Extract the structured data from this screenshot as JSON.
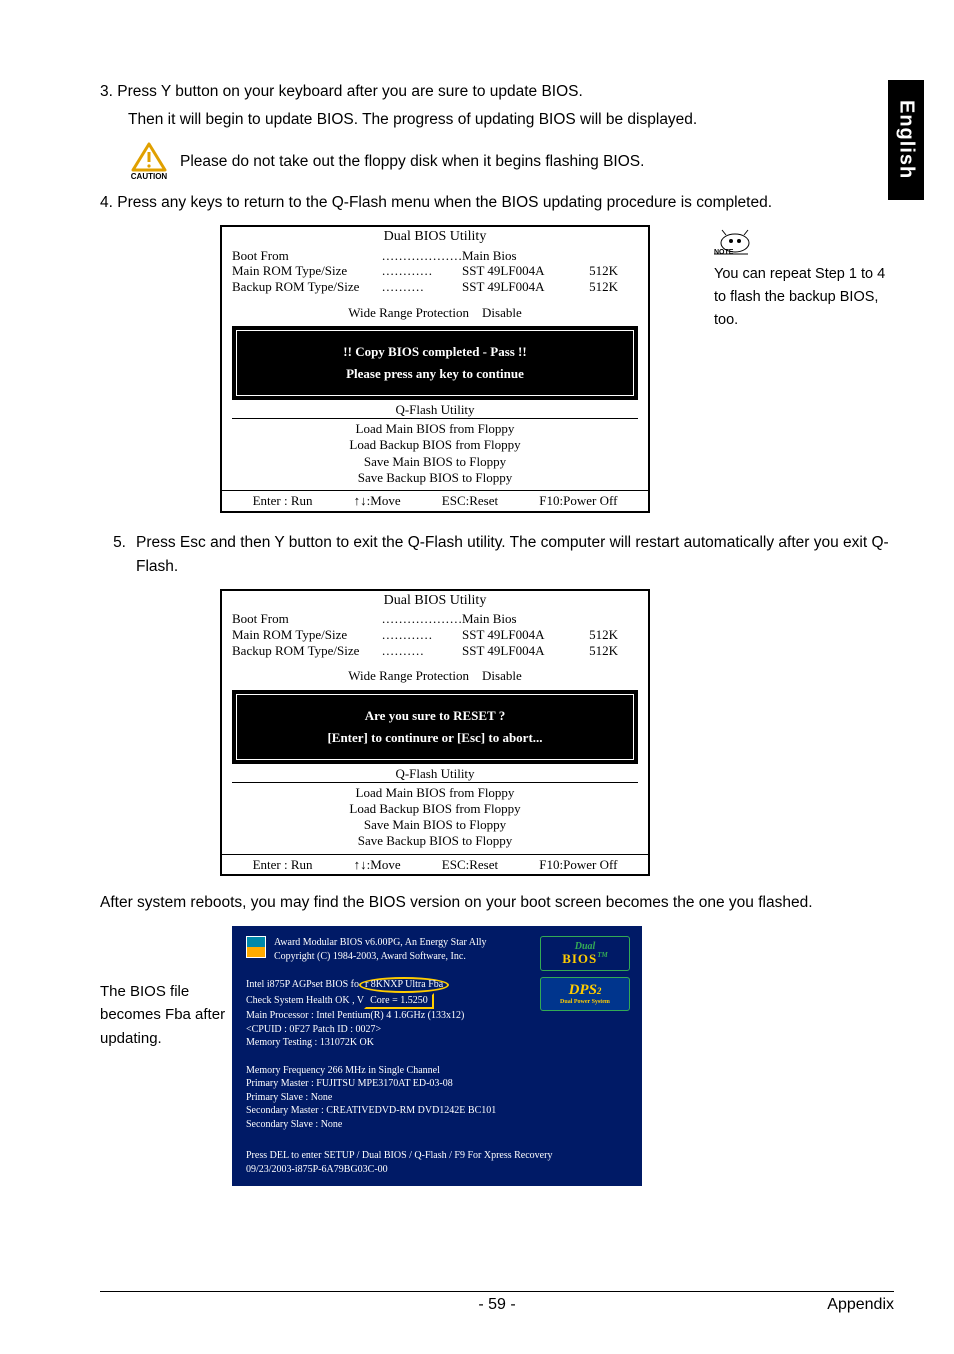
{
  "side_tab": "English",
  "step3_a": "3. Press Y button on your keyboard after you are sure to update BIOS.",
  "step3_b": "Then it will begin to update BIOS. The progress of updating BIOS will be displayed.",
  "caution_label": "CAUTION",
  "caution_text": "Please do not take out the floppy disk when it begins flashing BIOS.",
  "step4": "4. Press any keys to return to the Q-Flash menu when the BIOS updating procedure is completed.",
  "bios": {
    "title": "Dual BIOS Utility",
    "boot_from_label": "Boot From",
    "boot_from_val": "Main Bios",
    "main_rom_label": "Main ROM Type/Size",
    "main_rom_val": "SST 49LF004A",
    "main_rom_size": "512K",
    "backup_rom_label": "Backup ROM Type/Size",
    "backup_rom_val": "SST 49LF004A",
    "backup_rom_size": "512K",
    "wrp": "Wide Range Protection Disable",
    "box1_l1": "!! Copy BIOS completed - Pass !!",
    "box1_l2": "Please press any key to continue",
    "box2_l1": "Are you sure to RESET ?",
    "box2_l2": "[Enter] to continure or [Esc] to abort...",
    "qf_title": "Q-Flash Utility",
    "qf_menu": [
      "Load Main BIOS from Floppy",
      "Load Backup BIOS from Floppy",
      "Save Main BIOS to Floppy",
      "Save Backup BIOS to Floppy"
    ],
    "footer": {
      "enter": "Enter : Run",
      "move": "↑↓:Move",
      "esc": "ESC:Reset",
      "f10": "F10:Power Off"
    }
  },
  "note_label": "NOTE",
  "note_text": "You can repeat Step 1 to 4 to flash the backup BIOS, too.",
  "step5_num": "5.",
  "step5_txt": "Press Esc and then Y button to exit the Q-Flash utility. The computer will restart automatically after you exit Q-Flash.",
  "after_text": "After system reboots, you may find the BIOS version on your boot screen becomes the one you flashed.",
  "boot_note": "The BIOS file becomes Fba after updating.",
  "boot": {
    "award1": "Award Modular BIOS v6.00PG, An Energy Star Ally",
    "award2": "Copyright  (C)  1984-2003, Award Software,  Inc.",
    "l1a": "Intel i875P AGPset BIOS fo",
    "l1b": "r 8KNXP Ultra Fba",
    "l2a": "Check System Health OK ,  V",
    "l2b": "Core = 1.5250",
    "l3": "Main Processor : Intel Pentium(R) 4  1.6GHz (133x12)",
    "l4": "<CPUID : 0F27 Patch ID  : 0027>",
    "l5": "Memory Testing   : 131072K OK",
    "m1": "Memory Frequency 266 MHz in Single Channel",
    "m2": "Primary Master : FUJITSU MPE3170AT ED-03-08",
    "m3": "Primary Slave : None",
    "m4": "Secondary Master : CREATIVEDVD-RM DVD1242E BC101",
    "m5": "Secondary Slave : None",
    "b1": "Press DEL to enter SETUP / Dual BIOS / Q-Flash / F9 For Xpress Recovery",
    "b2": "09/23/2003-i875P-6A79BG03C-00",
    "logo_dual_top": "Dual",
    "logo_dual_bios": "BIOS",
    "logo_dps_top": "DPS",
    "logo_dps_sub": "Dual Power System"
  },
  "footer": {
    "page": "- 59 -",
    "section": "Appendix"
  }
}
